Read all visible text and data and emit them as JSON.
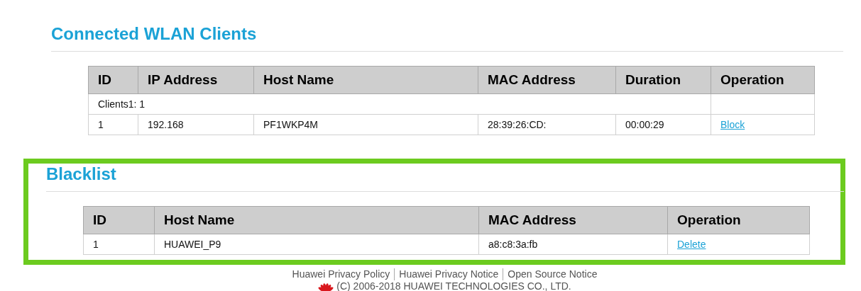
{
  "sections": [
    {
      "title": "Connected WLAN Clients",
      "highlighted": false,
      "columns": [
        "ID",
        "IP Address",
        "Host Name",
        "MAC Address",
        "Duration",
        "Operation"
      ],
      "rows": [
        {
          "kind": "group",
          "label": "Clients1: 1"
        },
        {
          "kind": "entry",
          "cells": [
            "1",
            "192.168",
            "PF1WKP4M",
            "28:39:26:CD:",
            "00:00:29"
          ],
          "action": "Block"
        }
      ]
    },
    {
      "title": "Blacklist",
      "highlighted": true,
      "columns": [
        "ID",
        "Host Name",
        "MAC Address",
        "Operation"
      ],
      "rows": [
        {
          "kind": "entry",
          "cells": [
            "1",
            "HUAWEI_P9",
            "a8:c8:3a:fb"
          ],
          "action": "Delete"
        }
      ]
    }
  ],
  "footer": {
    "links": [
      "Huawei Privacy Policy",
      "Huawei Privacy Notice",
      "Open Source Notice"
    ],
    "copyright": "(C) 2006-2018 HUAWEI TECHNOLOGIES CO., LTD."
  }
}
